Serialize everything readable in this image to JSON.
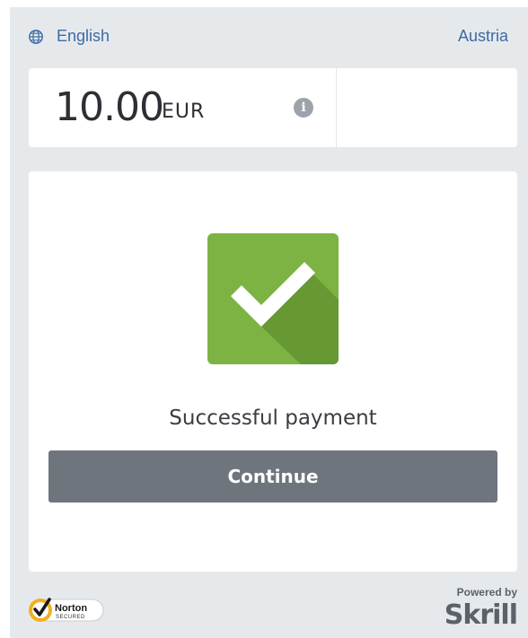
{
  "header": {
    "language": "English",
    "country": "Austria",
    "link_color": "#3b6ba5"
  },
  "amount": {
    "value": "10.00",
    "currency": "EUR",
    "info_icon": "i"
  },
  "status": {
    "message": "Successful payment",
    "icon": "checkmark-icon",
    "icon_color": "#7cb342"
  },
  "actions": {
    "continue_label": "Continue",
    "button_color": "#6e757d"
  },
  "footer": {
    "norton_brand": "Norton",
    "norton_tag": "SECURED",
    "powered_by": "Powered by",
    "provider": "Skrill"
  }
}
